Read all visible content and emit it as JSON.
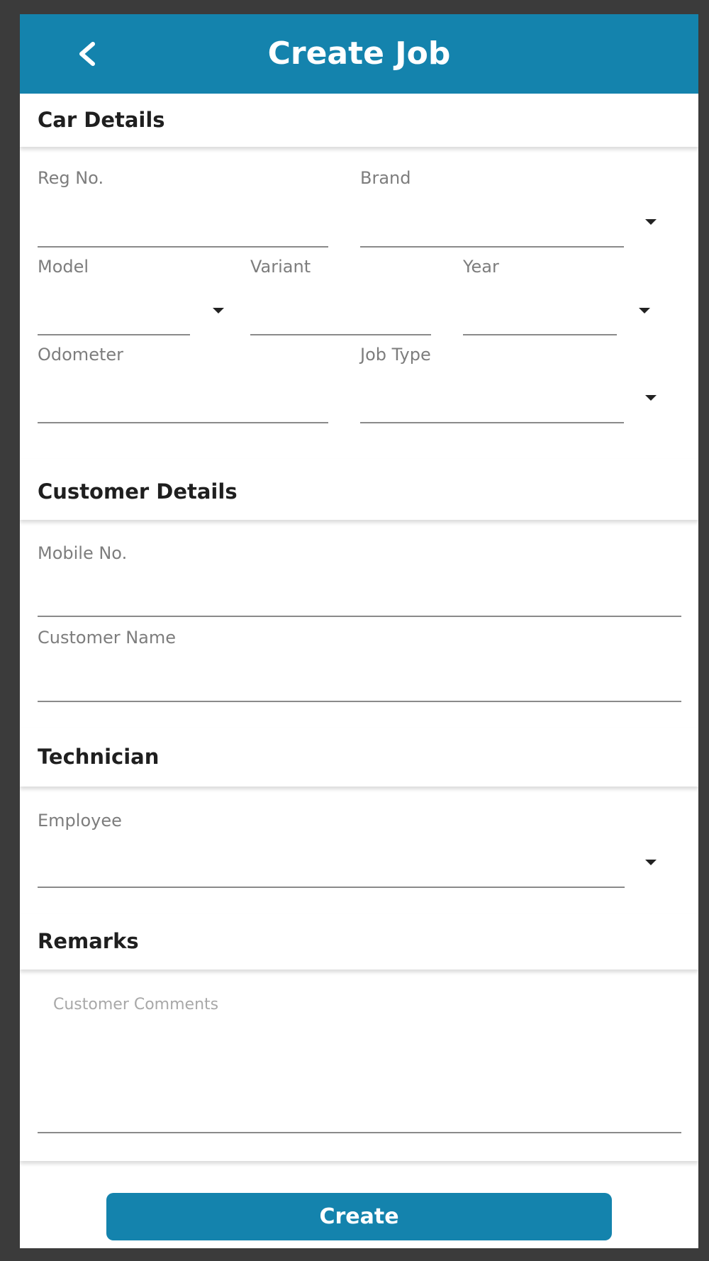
{
  "header": {
    "title": "Create Job",
    "back_icon": "chevron-left-icon"
  },
  "car_details": {
    "title": "Car Details",
    "reg_no_label": "Reg No.",
    "brand_label": "Brand",
    "model_label": "Model",
    "variant_label": "Variant",
    "year_label": "Year",
    "odometer_label": "Odometer",
    "job_type_label": "Job Type"
  },
  "customer_details": {
    "title": "Customer Details",
    "mobile_label": "Mobile No.",
    "name_label": "Customer Name"
  },
  "technician": {
    "title": "Technician",
    "employee_label": "Employee"
  },
  "remarks": {
    "title": "Remarks",
    "comments_placeholder": "Customer Comments"
  },
  "actions": {
    "create_label": "Create"
  },
  "colors": {
    "primary": "#1483ad",
    "background": "#3b3b3b"
  }
}
